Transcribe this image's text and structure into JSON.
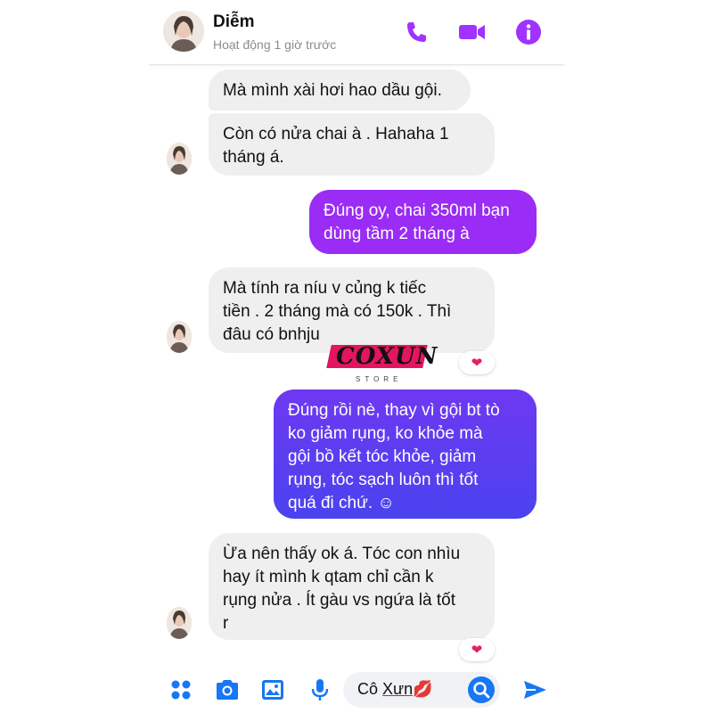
{
  "header": {
    "contact_name": "Diễm",
    "status": "Hoạt động 1 giờ trước",
    "icons": [
      "phone-icon",
      "video-camera-icon",
      "info-icon"
    ]
  },
  "colors": {
    "accent": "#a033ff",
    "outgoing_top": "#9a2cf5",
    "outgoing_bottom": "#5a3cf0",
    "incoming": "#efefef",
    "reaction": "#e0245e"
  },
  "messages": [
    {
      "side": "in",
      "lines": [
        "Mà mình xài hơi hao dầu gội."
      ]
    },
    {
      "side": "in",
      "lines": [
        "Còn có nửa chai à . Hahaha 1",
        "tháng á."
      ]
    },
    {
      "side": "out",
      "lines": [
        "Đúng oy, chai 350ml bạn",
        "dùng tầm 2 tháng à"
      ]
    },
    {
      "side": "in",
      "lines": [
        "Mà tính ra níu v củng k tiếc",
        "tiền . 2 tháng mà có 150k . Thì",
        "đâu có bnhju"
      ],
      "reaction": "❤"
    },
    {
      "side": "out",
      "lines": [
        "Đúng rồi nè, thay vì gội bt tò",
        "ko giảm rụng, ko khỏe mà",
        "gội bồ kết tóc khỏe, giảm",
        "rụng, tóc sạch luôn thì tốt",
        "quá đi chứ. ☺"
      ]
    },
    {
      "side": "in",
      "lines": [
        "Ừa nên thấy ok á. Tóc con nhìu",
        "hay ít mình k qtam chỉ cần k",
        "rụng nửa . Ít gàu vs ngứa là tốt",
        "r"
      ],
      "reaction": "❤"
    }
  ],
  "watermark": {
    "brand": "COXUN",
    "sub": "STORE"
  },
  "composer": {
    "input_value_prefix": "Cô ",
    "input_value_underlined": "Xưn",
    "input_emoji": "💋",
    "icons": [
      "apps-grid-icon",
      "camera-icon",
      "image-icon",
      "microphone-icon",
      "search-icon",
      "send-icon"
    ]
  }
}
